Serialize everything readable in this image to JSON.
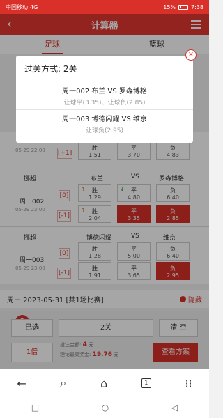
{
  "statusbar": {
    "carrier": "中国移动",
    "signal": "4G",
    "battery": "15%",
    "time": "7:38"
  },
  "header": {
    "title": "计算器",
    "back_icon": "back-arrow-icon",
    "menu_icon": "menu-icon"
  },
  "tabs": [
    {
      "label": "足球",
      "active": true
    },
    {
      "label": "篮球",
      "active": false
    }
  ],
  "rows": {
    "r0": {
      "date": "05-29 22:00",
      "hcp": "+1",
      "cells": [
        {
          "t": "胜",
          "o": "1.51"
        },
        {
          "t": "平",
          "o": "3.70"
        },
        {
          "t": "负",
          "o": "4.83"
        }
      ]
    },
    "r1": {
      "type": "挪超",
      "home": "布兰",
      "vs": "VS",
      "away": "罗森博格",
      "id": "周一002",
      "date": "05-29 23:00",
      "hcp0": "0",
      "hcp1": "-1",
      "cells0": [
        {
          "t": "胜",
          "o": "1.29"
        },
        {
          "t": "平",
          "o": "4.80"
        },
        {
          "t": "负",
          "o": "6.40"
        }
      ],
      "cells1": [
        {
          "t": "胜",
          "o": "2.04"
        },
        {
          "t": "平",
          "o": "3.35"
        },
        {
          "t": "负",
          "o": "2.85"
        }
      ]
    },
    "r2": {
      "type": "挪超",
      "home": "博德闪耀",
      "vs": "VS",
      "away": "维京",
      "id": "周一003",
      "date": "05-29 23:00",
      "hcp0": "0",
      "hcp1": "-1",
      "cells0": [
        {
          "t": "胜",
          "o": "1.28"
        },
        {
          "t": "平",
          "o": "5.00"
        },
        {
          "t": "负",
          "o": "6.40"
        }
      ],
      "cells1": [
        {
          "t": "胜",
          "o": "1.91"
        },
        {
          "t": "平",
          "o": "3.65"
        },
        {
          "t": "负",
          "o": "2.95"
        }
      ]
    }
  },
  "day": {
    "label": "周三 2023-05-31 [共1场比赛]",
    "hide": "隐藏"
  },
  "bottom": {
    "selected_count": "2",
    "selected_btn": "已选",
    "pass_btn": "2关",
    "clear_btn": "清 空",
    "multiple_btn": "1倍",
    "bet_label": "投注金额:",
    "bet_value": "4",
    "bet_unit": "元",
    "prize_label": "理论最高奖金:",
    "prize_value": "19.76",
    "prize_unit": "元",
    "view_btn": "查看方案"
  },
  "popup": {
    "title": "过关方式:  2关",
    "items": [
      {
        "match": "周一002 布兰 VS 罗森博格",
        "sub": "让球平(3.35)、让球负(2.85)"
      },
      {
        "match": "周一003 博德闪耀 VS 维京",
        "sub": "让球负(2.95)"
      }
    ],
    "close": "×"
  },
  "navbar": {
    "tab_count": "1"
  },
  "colors": {
    "brand": "#d9302a",
    "header": "#e1372f"
  }
}
